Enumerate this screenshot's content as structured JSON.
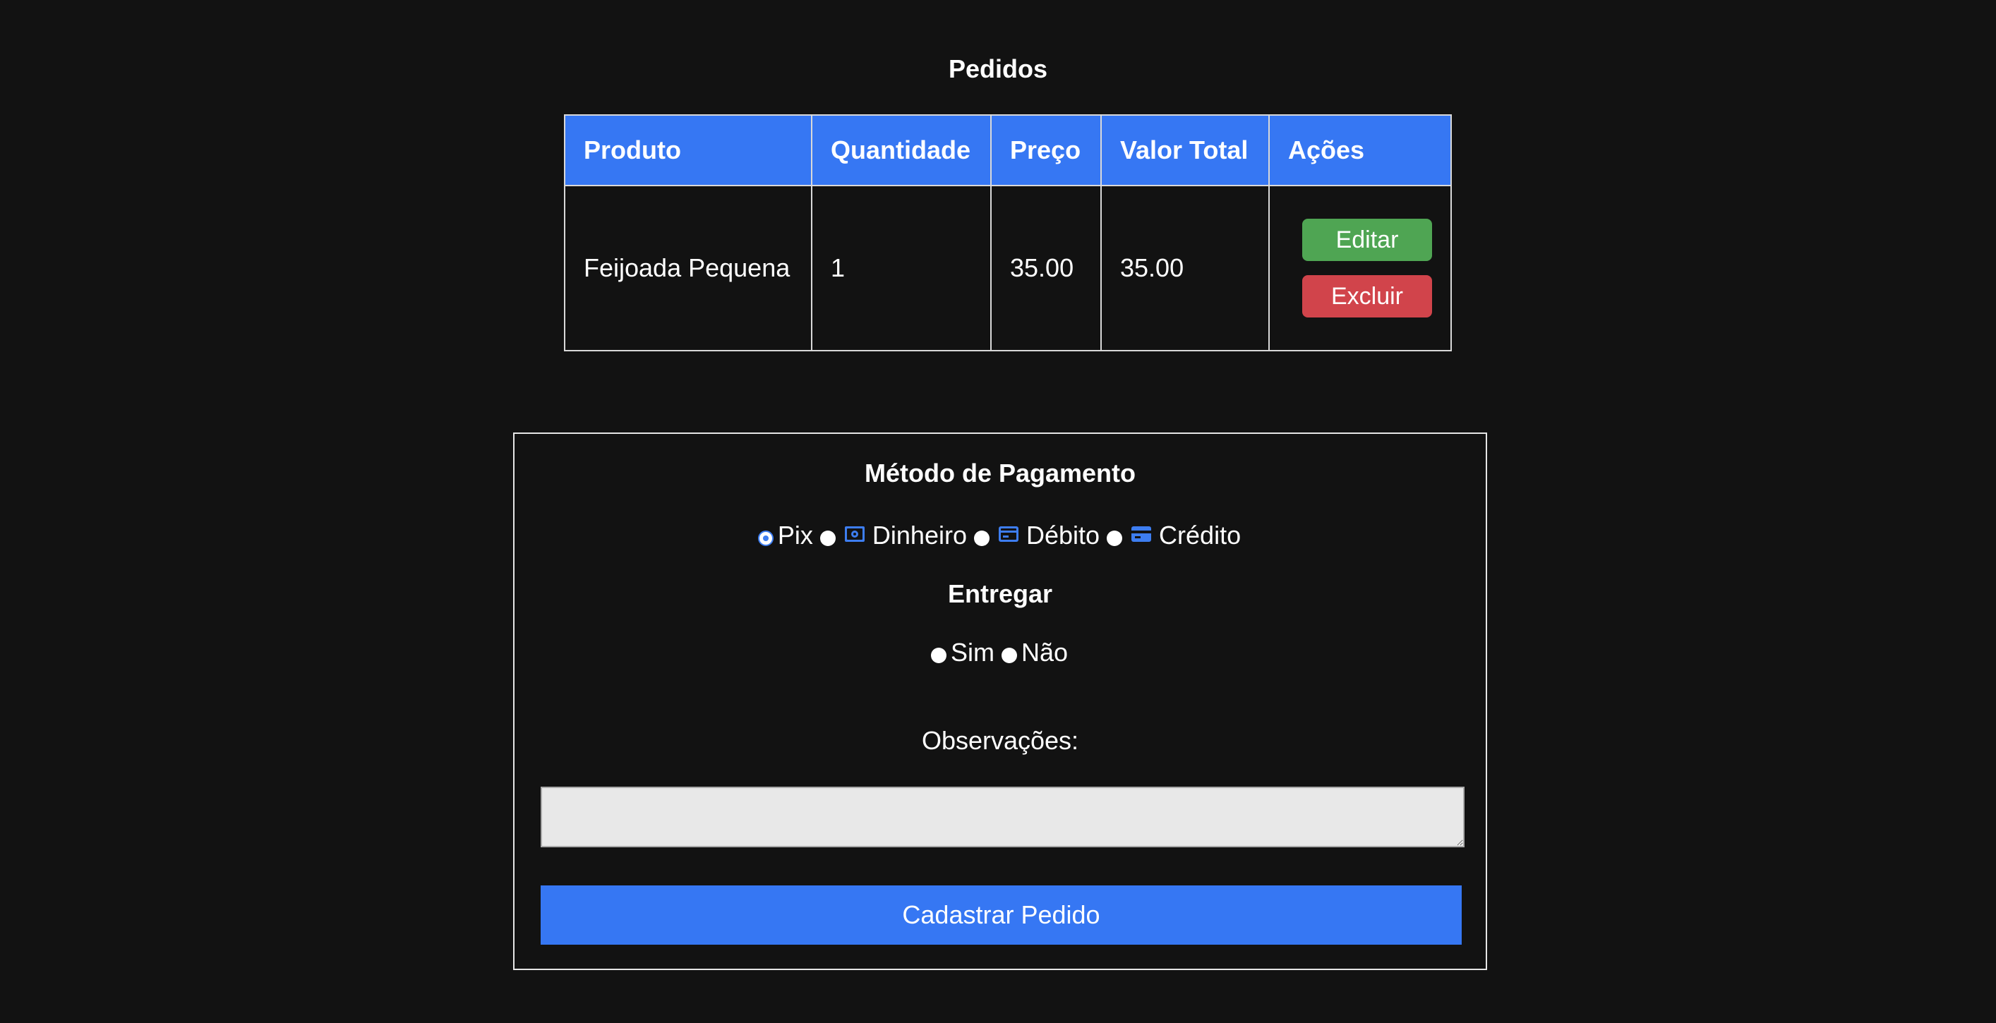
{
  "page": {
    "title": "Pedidos"
  },
  "orders_table": {
    "headers": {
      "produto": "Produto",
      "quantidade": "Quantidade",
      "preco": "Preço",
      "valor_total": "Valor Total",
      "acoes": "Ações"
    },
    "rows": [
      {
        "produto": "Feijoada Pequena",
        "quantidade": "1",
        "preco": "35.00",
        "valor_total": "35.00",
        "edit_label": "Editar",
        "delete_label": "Excluir"
      }
    ]
  },
  "payment": {
    "title": "Método de Pagamento",
    "options": [
      {
        "label": "Pix",
        "checked": true,
        "icon": ""
      },
      {
        "label": "Dinheiro",
        "checked": false,
        "icon": "cash-icon"
      },
      {
        "label": "Débito",
        "checked": false,
        "icon": "debit-card-icon"
      },
      {
        "label": "Crédito",
        "checked": false,
        "icon": "credit-card-icon"
      }
    ]
  },
  "delivery": {
    "title": "Entregar",
    "options": [
      {
        "label": "Sim",
        "checked": false
      },
      {
        "label": "Não",
        "checked": false
      }
    ]
  },
  "observations": {
    "label": "Observações:",
    "value": ""
  },
  "submit": {
    "label": "Cadastrar Pedido"
  },
  "colors": {
    "background": "#121212",
    "primary": "#3677f3",
    "edit": "#4fa553",
    "delete": "#d1444b",
    "icon": "#3d7df0"
  }
}
